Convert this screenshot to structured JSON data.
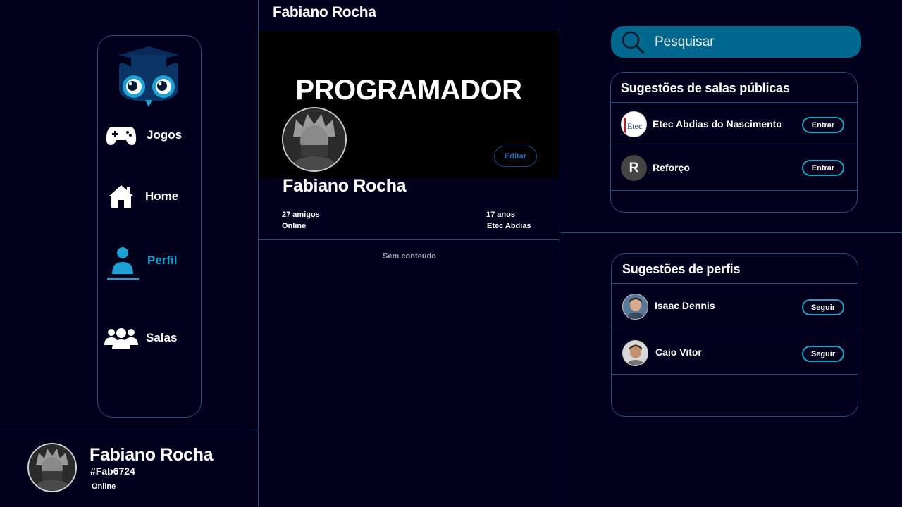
{
  "sidebar": {
    "items": [
      {
        "label": "Jogos",
        "icon": "gamepad-icon"
      },
      {
        "label": "Home",
        "icon": "home-icon"
      },
      {
        "label": "Perfil",
        "icon": "user-icon",
        "active": true
      },
      {
        "label": "Salas",
        "icon": "group-icon"
      }
    ]
  },
  "current_user": {
    "name": "Fabiano Rocha",
    "tag": "#Fab6724",
    "status": "Online"
  },
  "header": {
    "title": "Fabiano Rocha"
  },
  "profile": {
    "cover_text": "PROGRAMADOR",
    "edit_label": "Editar",
    "name": "Fabiano Rocha",
    "friends": "27 amigos",
    "status": "Online",
    "age": "17 anos",
    "school": "Etec Abdias",
    "empty_message": "Sem conteúdo"
  },
  "search": {
    "placeholder": "Pesquisar"
  },
  "rooms": {
    "title": "Sugestões de salas públicas",
    "items": [
      {
        "name": "Etec Abdias do Nascimento",
        "avatar_text": "Etec",
        "action": "Entrar"
      },
      {
        "name": "Reforço",
        "avatar_text": "R",
        "action": "Entrar"
      }
    ]
  },
  "profiles": {
    "title": "Sugestões de perfis",
    "items": [
      {
        "name": "Isaac Dennis",
        "action": "Seguir"
      },
      {
        "name": "Caio Vitor",
        "action": "Seguir"
      }
    ]
  },
  "colors": {
    "background": "#00001c",
    "accent": "#1ea2d6",
    "search_bg": "#00688e",
    "border": "#2a4a7a"
  }
}
